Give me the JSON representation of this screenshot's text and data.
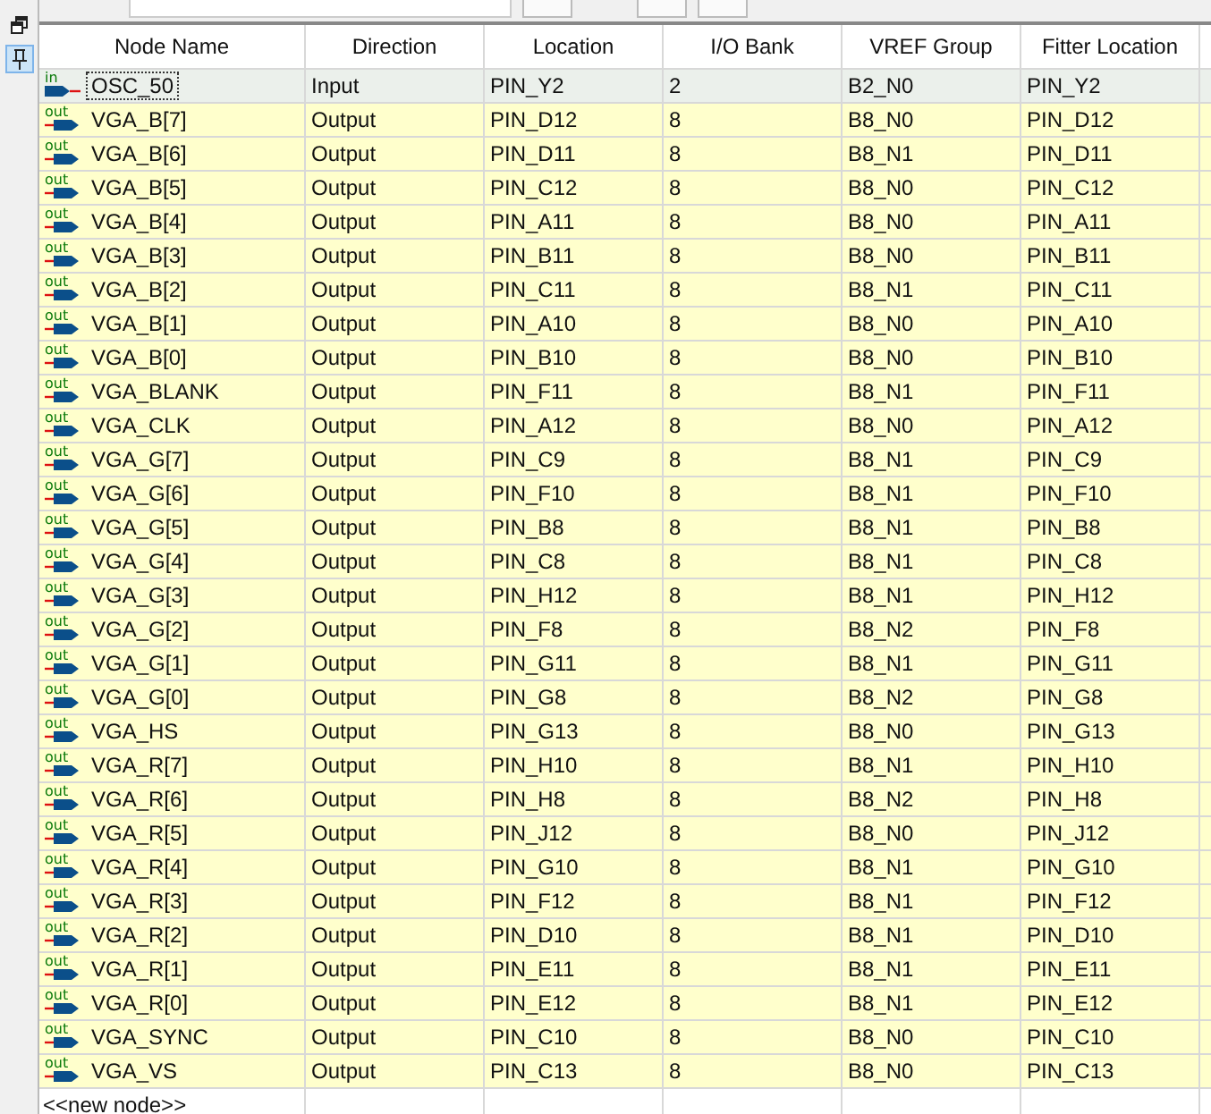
{
  "sidebar": {
    "items": [
      {
        "kind": "restore",
        "selected": false
      },
      {
        "kind": "pin",
        "selected": true
      }
    ]
  },
  "table": {
    "columns": [
      "Node Name",
      "Direction",
      "Location",
      "I/O Bank",
      "VREF Group",
      "Fitter Location"
    ],
    "rows": [
      {
        "kind": "input",
        "io_label": "in",
        "selected": true,
        "cells": [
          "OSC_50",
          "Input",
          "PIN_Y2",
          "2",
          "B2_N0",
          "PIN_Y2"
        ]
      },
      {
        "kind": "output",
        "io_label": "out",
        "selected": false,
        "cells": [
          "VGA_B[7]",
          "Output",
          "PIN_D12",
          "8",
          "B8_N0",
          "PIN_D12"
        ]
      },
      {
        "kind": "output",
        "io_label": "out",
        "selected": false,
        "cells": [
          "VGA_B[6]",
          "Output",
          "PIN_D11",
          "8",
          "B8_N1",
          "PIN_D11"
        ]
      },
      {
        "kind": "output",
        "io_label": "out",
        "selected": false,
        "cells": [
          "VGA_B[5]",
          "Output",
          "PIN_C12",
          "8",
          "B8_N0",
          "PIN_C12"
        ]
      },
      {
        "kind": "output",
        "io_label": "out",
        "selected": false,
        "cells": [
          "VGA_B[4]",
          "Output",
          "PIN_A11",
          "8",
          "B8_N0",
          "PIN_A11"
        ]
      },
      {
        "kind": "output",
        "io_label": "out",
        "selected": false,
        "cells": [
          "VGA_B[3]",
          "Output",
          "PIN_B11",
          "8",
          "B8_N0",
          "PIN_B11"
        ]
      },
      {
        "kind": "output",
        "io_label": "out",
        "selected": false,
        "cells": [
          "VGA_B[2]",
          "Output",
          "PIN_C11",
          "8",
          "B8_N1",
          "PIN_C11"
        ]
      },
      {
        "kind": "output",
        "io_label": "out",
        "selected": false,
        "cells": [
          "VGA_B[1]",
          "Output",
          "PIN_A10",
          "8",
          "B8_N0",
          "PIN_A10"
        ]
      },
      {
        "kind": "output",
        "io_label": "out",
        "selected": false,
        "cells": [
          "VGA_B[0]",
          "Output",
          "PIN_B10",
          "8",
          "B8_N0",
          "PIN_B10"
        ]
      },
      {
        "kind": "output",
        "io_label": "out",
        "selected": false,
        "cells": [
          "VGA_BLANK",
          "Output",
          "PIN_F11",
          "8",
          "B8_N1",
          "PIN_F11"
        ]
      },
      {
        "kind": "output",
        "io_label": "out",
        "selected": false,
        "cells": [
          "VGA_CLK",
          "Output",
          "PIN_A12",
          "8",
          "B8_N0",
          "PIN_A12"
        ]
      },
      {
        "kind": "output",
        "io_label": "out",
        "selected": false,
        "cells": [
          "VGA_G[7]",
          "Output",
          "PIN_C9",
          "8",
          "B8_N1",
          "PIN_C9"
        ]
      },
      {
        "kind": "output",
        "io_label": "out",
        "selected": false,
        "cells": [
          "VGA_G[6]",
          "Output",
          "PIN_F10",
          "8",
          "B8_N1",
          "PIN_F10"
        ]
      },
      {
        "kind": "output",
        "io_label": "out",
        "selected": false,
        "cells": [
          "VGA_G[5]",
          "Output",
          "PIN_B8",
          "8",
          "B8_N1",
          "PIN_B8"
        ]
      },
      {
        "kind": "output",
        "io_label": "out",
        "selected": false,
        "cells": [
          "VGA_G[4]",
          "Output",
          "PIN_C8",
          "8",
          "B8_N1",
          "PIN_C8"
        ]
      },
      {
        "kind": "output",
        "io_label": "out",
        "selected": false,
        "cells": [
          "VGA_G[3]",
          "Output",
          "PIN_H12",
          "8",
          "B8_N1",
          "PIN_H12"
        ]
      },
      {
        "kind": "output",
        "io_label": "out",
        "selected": false,
        "cells": [
          "VGA_G[2]",
          "Output",
          "PIN_F8",
          "8",
          "B8_N2",
          "PIN_F8"
        ]
      },
      {
        "kind": "output",
        "io_label": "out",
        "selected": false,
        "cells": [
          "VGA_G[1]",
          "Output",
          "PIN_G11",
          "8",
          "B8_N1",
          "PIN_G11"
        ]
      },
      {
        "kind": "output",
        "io_label": "out",
        "selected": false,
        "cells": [
          "VGA_G[0]",
          "Output",
          "PIN_G8",
          "8",
          "B8_N2",
          "PIN_G8"
        ]
      },
      {
        "kind": "output",
        "io_label": "out",
        "selected": false,
        "cells": [
          "VGA_HS",
          "Output",
          "PIN_G13",
          "8",
          "B8_N0",
          "PIN_G13"
        ]
      },
      {
        "kind": "output",
        "io_label": "out",
        "selected": false,
        "cells": [
          "VGA_R[7]",
          "Output",
          "PIN_H10",
          "8",
          "B8_N1",
          "PIN_H10"
        ]
      },
      {
        "kind": "output",
        "io_label": "out",
        "selected": false,
        "cells": [
          "VGA_R[6]",
          "Output",
          "PIN_H8",
          "8",
          "B8_N2",
          "PIN_H8"
        ]
      },
      {
        "kind": "output",
        "io_label": "out",
        "selected": false,
        "cells": [
          "VGA_R[5]",
          "Output",
          "PIN_J12",
          "8",
          "B8_N0",
          "PIN_J12"
        ]
      },
      {
        "kind": "output",
        "io_label": "out",
        "selected": false,
        "cells": [
          "VGA_R[4]",
          "Output",
          "PIN_G10",
          "8",
          "B8_N1",
          "PIN_G10"
        ]
      },
      {
        "kind": "output",
        "io_label": "out",
        "selected": false,
        "cells": [
          "VGA_R[3]",
          "Output",
          "PIN_F12",
          "8",
          "B8_N1",
          "PIN_F12"
        ]
      },
      {
        "kind": "output",
        "io_label": "out",
        "selected": false,
        "cells": [
          "VGA_R[2]",
          "Output",
          "PIN_D10",
          "8",
          "B8_N1",
          "PIN_D10"
        ]
      },
      {
        "kind": "output",
        "io_label": "out",
        "selected": false,
        "cells": [
          "VGA_R[1]",
          "Output",
          "PIN_E11",
          "8",
          "B8_N1",
          "PIN_E11"
        ]
      },
      {
        "kind": "output",
        "io_label": "out",
        "selected": false,
        "cells": [
          "VGA_R[0]",
          "Output",
          "PIN_E12",
          "8",
          "B8_N1",
          "PIN_E12"
        ]
      },
      {
        "kind": "output",
        "io_label": "out",
        "selected": false,
        "cells": [
          "VGA_SYNC",
          "Output",
          "PIN_C10",
          "8",
          "B8_N0",
          "PIN_C10"
        ]
      },
      {
        "kind": "output",
        "io_label": "out",
        "selected": false,
        "cells": [
          "VGA_VS",
          "Output",
          "PIN_C13",
          "8",
          "B8_N0",
          "PIN_C13"
        ]
      }
    ],
    "new_row": "<<new node>>"
  }
}
